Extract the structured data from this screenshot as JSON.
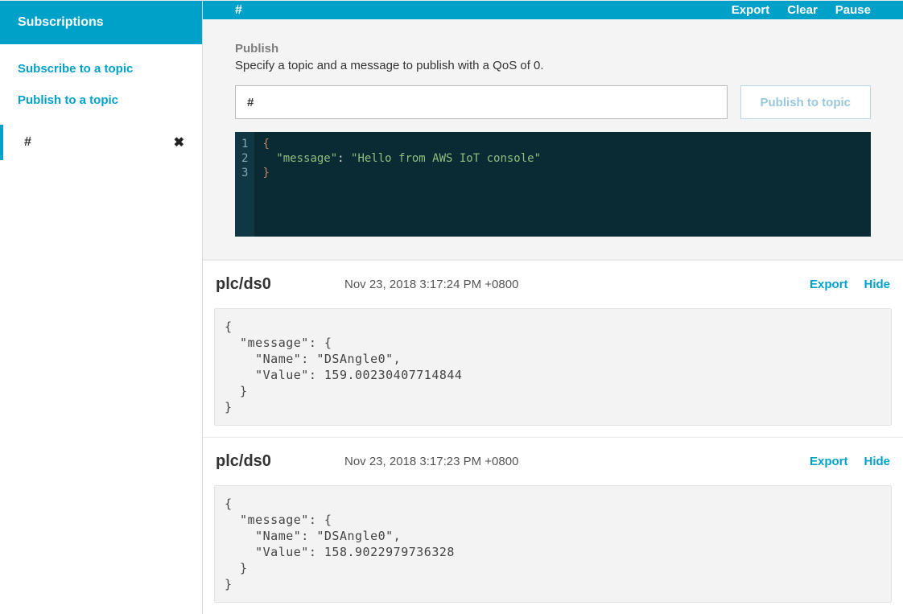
{
  "sidebar": {
    "title": "Subscriptions",
    "links": {
      "subscribe": "Subscribe to a topic",
      "publish": "Publish to a topic"
    },
    "active_subscription": "#"
  },
  "topbar": {
    "title": "#",
    "actions": {
      "export": "Export",
      "clear": "Clear",
      "pause": "Pause"
    }
  },
  "publish": {
    "heading": "Publish",
    "description": "Specify a topic and a message to publish with a QoS of 0.",
    "topic_value": "#",
    "button_label": "Publish to topic",
    "editor_lines": [
      "1",
      "2",
      "3"
    ],
    "editor_code_html": "<span class='brace'>{</span>\n  <span class='key'>\"message\"</span>: <span class='str'>\"Hello from AWS IoT console\"</span>\n<span class='brace'>}</span>"
  },
  "messages": [
    {
      "topic": "plc/ds0",
      "timestamp": "Nov 23, 2018 3:17:24 PM +0800",
      "actions": {
        "export": "Export",
        "hide": "Hide"
      },
      "payload": "{\n  \"message\": {\n    \"Name\": \"DSAngle0\",\n    \"Value\": 159.00230407714844\n  }\n}"
    },
    {
      "topic": "plc/ds0",
      "timestamp": "Nov 23, 2018 3:17:23 PM +0800",
      "actions": {
        "export": "Export",
        "hide": "Hide"
      },
      "payload": "{\n  \"message\": {\n    \"Name\": \"DSAngle0\",\n    \"Value\": 158.9022979736328\n  }\n}"
    }
  ]
}
